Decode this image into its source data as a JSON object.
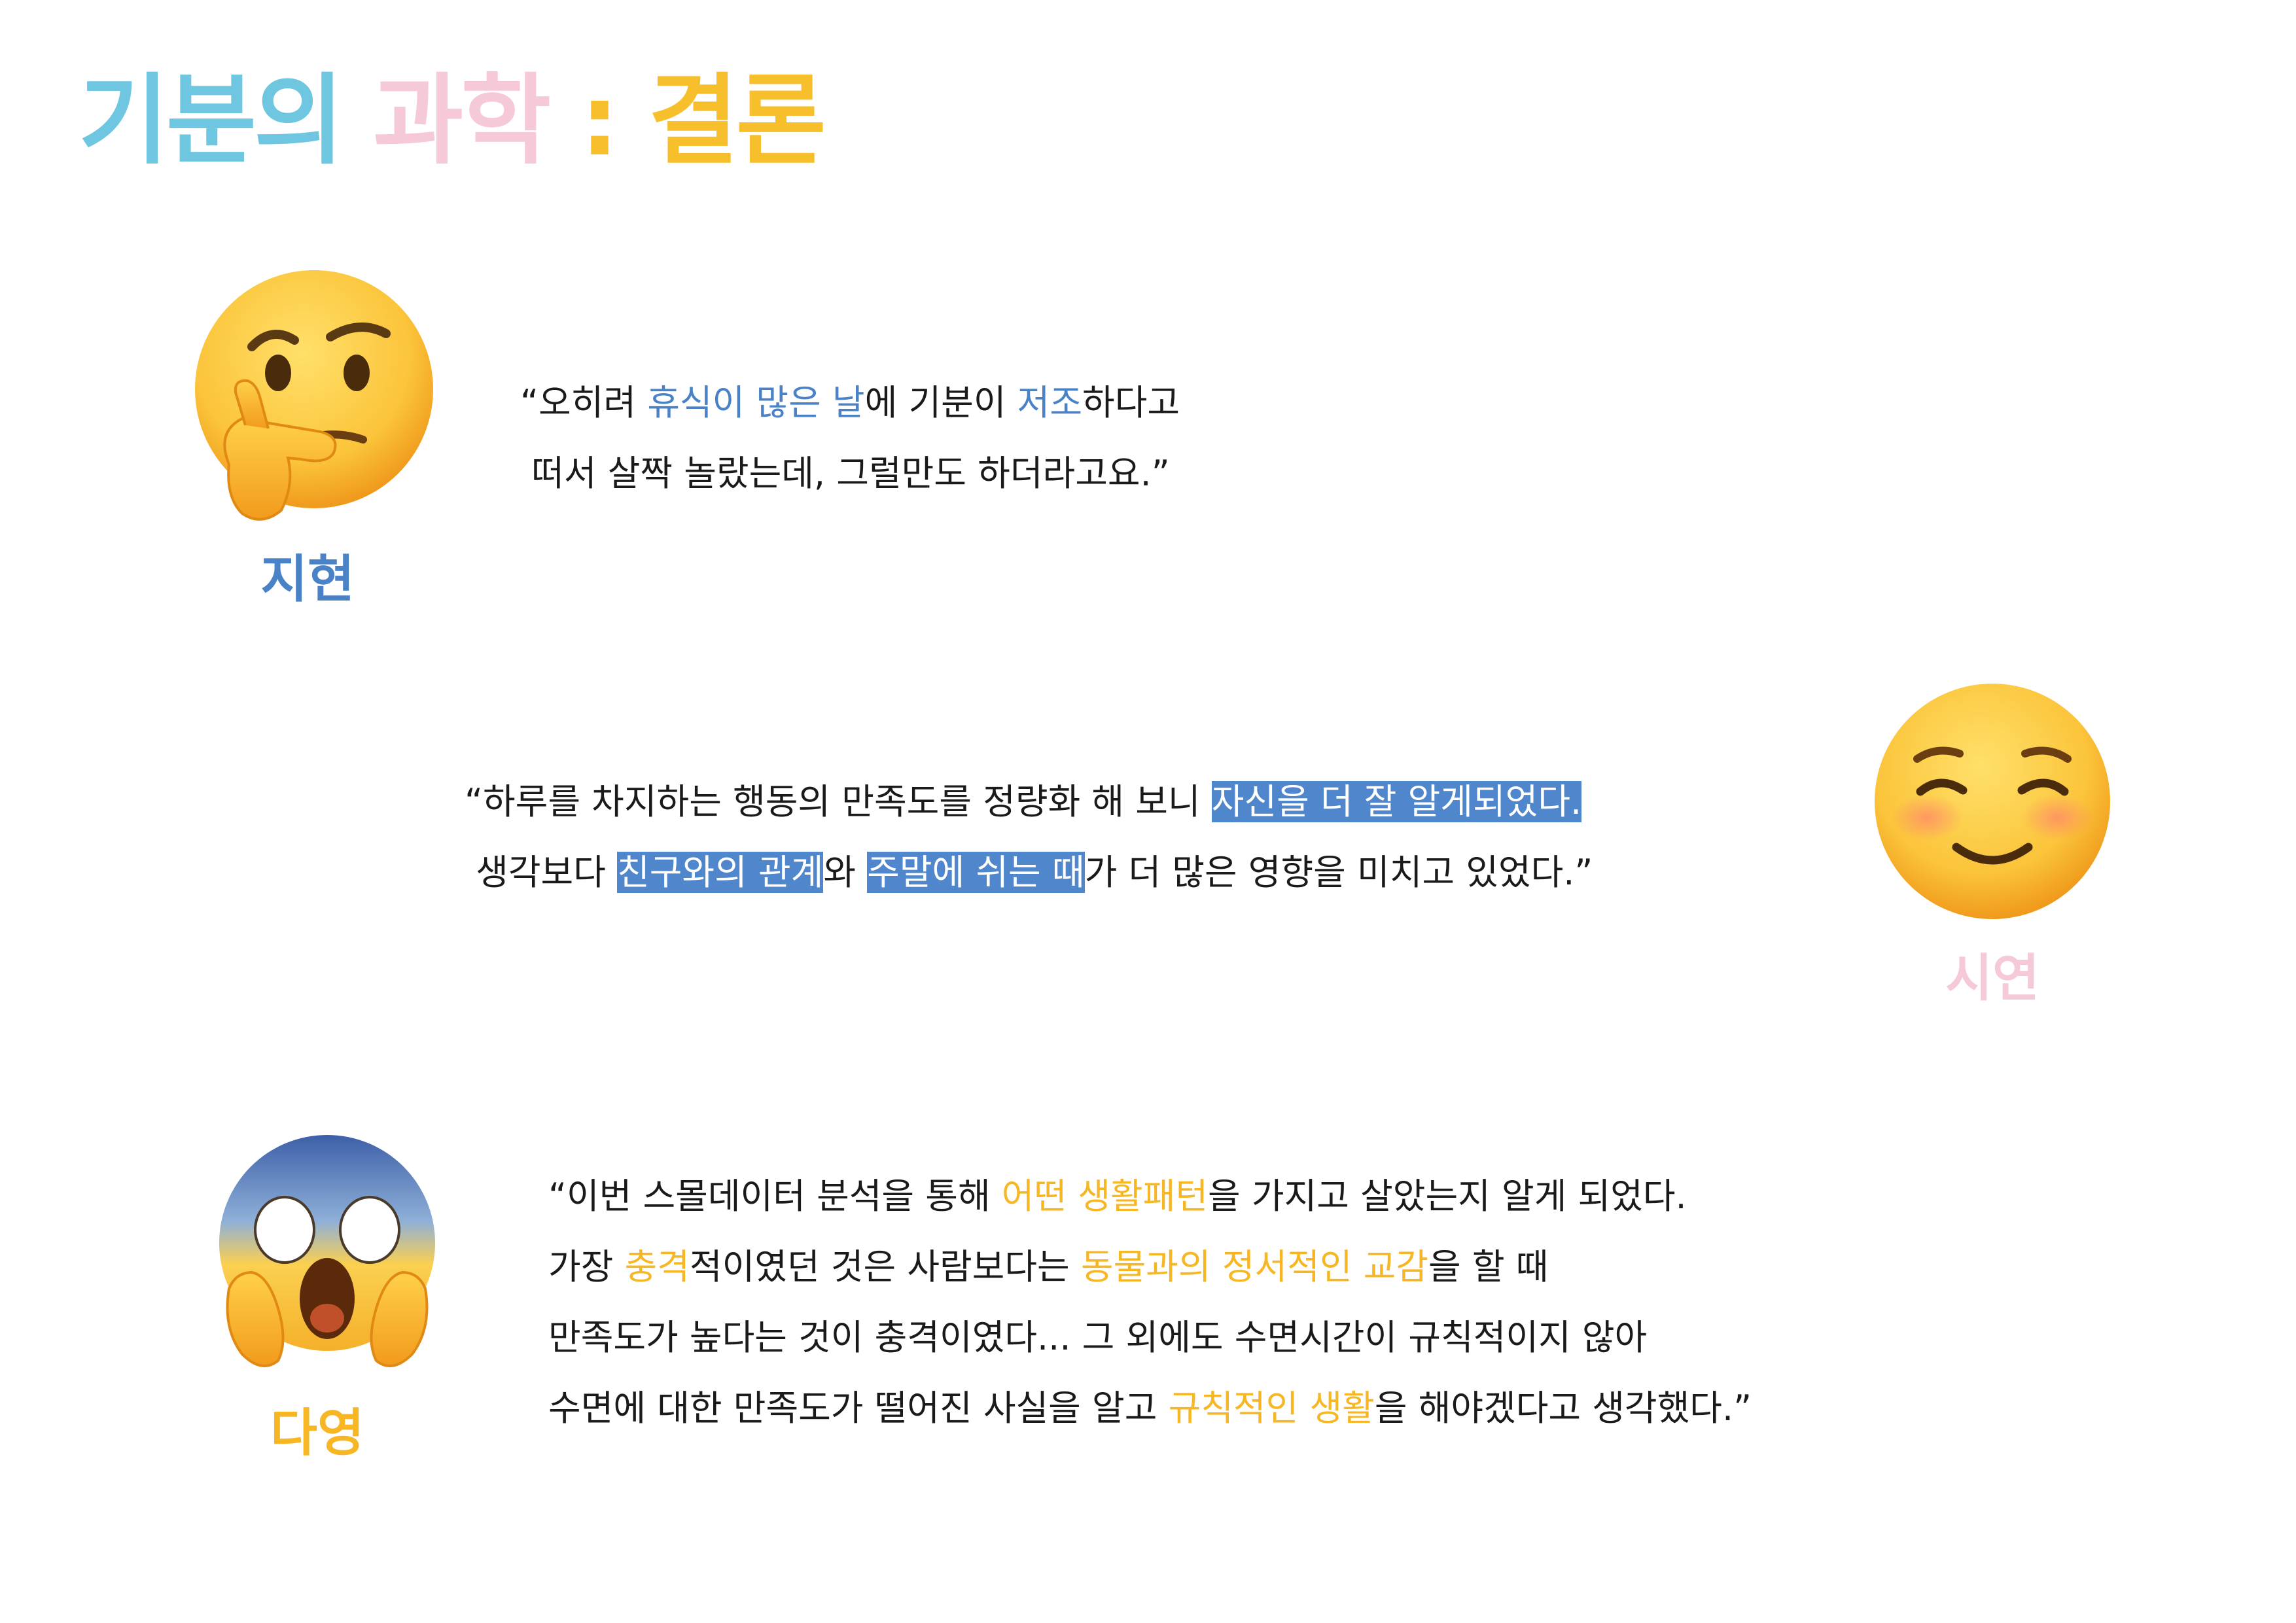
{
  "title": {
    "part1": "기분의",
    "part2": "과학",
    "part3": ": 결론"
  },
  "colors": {
    "title_cyan": "#6ec6e0",
    "title_pink": "#f5c9d8",
    "title_yellow": "#f7bf2c",
    "accent_blue": "#4a82c8",
    "accent_yellow": "#f7b724",
    "highlight_blue": "#4f86cc"
  },
  "sections": [
    {
      "name": "지현",
      "icon": "thinking-face-icon",
      "lines": [
        [
          "“오히려 ",
          "휴식이 많은 날",
          "에 기분이 ",
          "저조",
          "하다고"
        ],
        [
          " 떠서 살짝 놀랐는데, 그럴만도 하더라고요.”"
        ]
      ]
    },
    {
      "name": "시연",
      "icon": "smiling-face-icon",
      "lines": [
        [
          "“하루를 차지하는 행동의 만족도를 정량화 해 보니 ",
          "자신을 더 잘 알게되었다.",
          ""
        ],
        [
          " 생각보다 ",
          "친구와의 관계",
          "와 ",
          "주말에 쉬는 때",
          "가 더 많은 영향을 미치고 있었다.”"
        ]
      ]
    },
    {
      "name": "다영",
      "icon": "screaming-face-icon",
      "lines": [
        [
          "“이번 스몰데이터 분석을 통해 ",
          "어떤 생활패턴",
          "을 가지고 살았는지 알게 되었다."
        ],
        [
          "가장 ",
          "충격",
          "적이였던 것은 사람보다는 ",
          "동물과의 정서적인 교감",
          "을 할 때"
        ],
        [
          "만족도가 높다는 것이 충격이였다... 그 외에도 수면시간이 규칙적이지 않아"
        ],
        [
          "수면에 대한 만족도가 떨어진 사실을 알고 ",
          "규칙적인 생활",
          "을 해야겠다고 생각했다.”"
        ]
      ]
    }
  ]
}
